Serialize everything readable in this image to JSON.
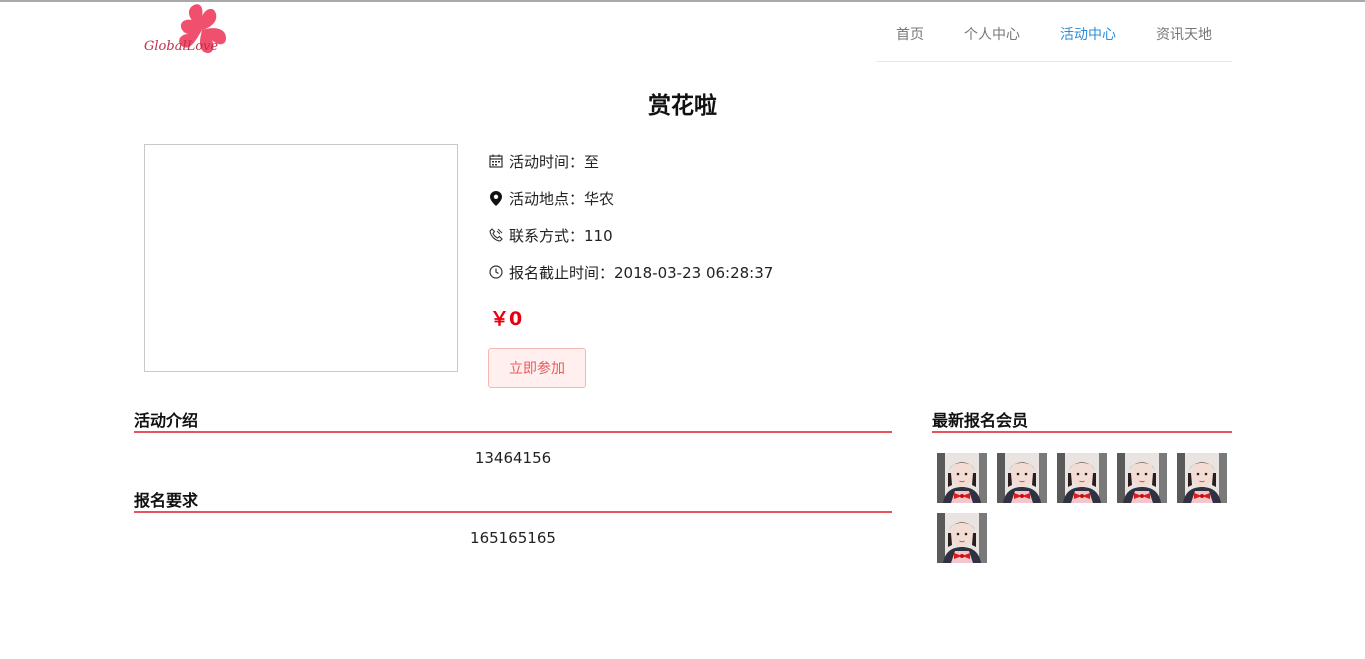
{
  "header": {
    "logo_text": "GlobalLove",
    "nav": [
      {
        "label": "首页",
        "active": false
      },
      {
        "label": "个人中心",
        "active": false
      },
      {
        "label": "活动中心",
        "active": true
      },
      {
        "label": "资讯天地",
        "active": false
      }
    ]
  },
  "activity": {
    "title": "赏花啦",
    "time_label": "活动时间：至",
    "place_label": "活动地点：华农",
    "contact_label": "联系方式：110",
    "deadline_label": "报名截止时间：2018-03-23 06:28:37",
    "price": "￥0",
    "join_label": "立即参加"
  },
  "sections": {
    "intro_title": "活动介绍",
    "intro_body": "13464156",
    "req_title": "报名要求",
    "req_body": "165165165",
    "members_title": "最新报名会员"
  },
  "members": {
    "count": 6
  },
  "colors": {
    "accent": "#e8525f",
    "price": "#e60012",
    "nav_active": "#2d8fd8"
  }
}
